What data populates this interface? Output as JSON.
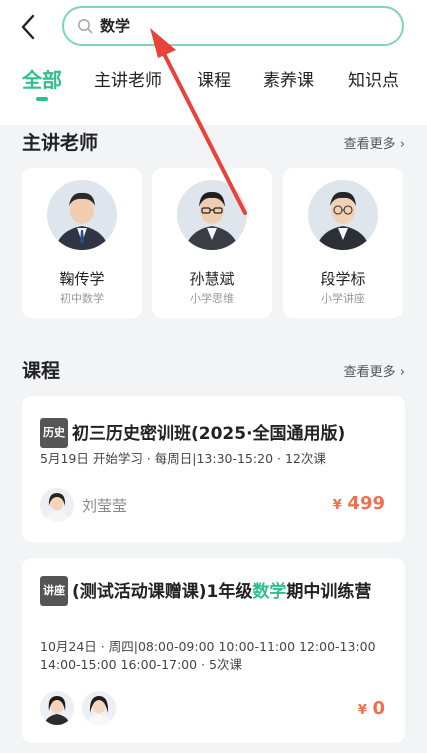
{
  "search": {
    "query": "数学"
  },
  "tabs": [
    {
      "label": "全部",
      "active": true
    },
    {
      "label": "主讲老师"
    },
    {
      "label": "课程"
    },
    {
      "label": "素养课"
    },
    {
      "label": "知识点"
    }
  ],
  "teachers_section": {
    "title": "主讲老师",
    "more": "查看更多 ›"
  },
  "teachers": [
    {
      "name": "鞠传学",
      "subtitle": "初中数学"
    },
    {
      "name": "孙慧斌",
      "subtitle": "小学思维"
    },
    {
      "name": "段学标",
      "subtitle": "小学讲座"
    }
  ],
  "courses_section": {
    "title": "课程",
    "more": "查看更多 ›"
  },
  "courses": [
    {
      "badge": "历史",
      "title": "初三历史密训班(2025·全国通用版)",
      "meta": "5月19日 开始学习 · 每周日|13:30-15:20 · 12次课",
      "teacher": "刘莹莹",
      "currency": "¥",
      "price": "499"
    },
    {
      "badge": "讲座",
      "title_pre": "(测试活动课赠课)1年级",
      "title_highlight": "数学",
      "title_post": "期中训练营",
      "meta": "10月24日 · 周四|08:00-09:00 10:00-11:00 12:00-13:00 14:00-15:00 16:00-17:00 · 5次课",
      "currency": "¥",
      "price": "0"
    }
  ],
  "colors": {
    "accent": "#2fbf8e",
    "price": "#f0704e",
    "annotation_arrow": "#e8423a"
  }
}
